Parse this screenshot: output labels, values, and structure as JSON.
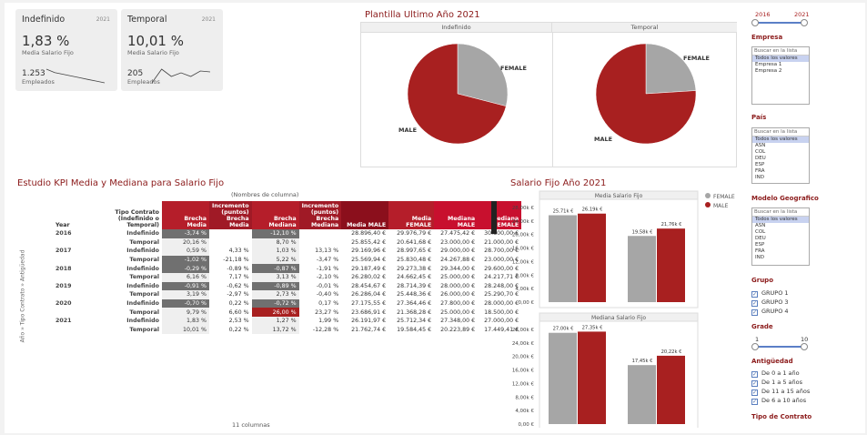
{
  "kpis": [
    {
      "title": "Indefinido",
      "year": "2021",
      "pct": "1,83 %",
      "pct_label": "Media Salario Fijo",
      "count": "1.253",
      "count_label": "Empleados",
      "spark": [
        22,
        20,
        19,
        18,
        17,
        16,
        15,
        14
      ]
    },
    {
      "title": "Temporal",
      "year": "2021",
      "pct": "10,01 %",
      "pct_label": "Media Salario Fijo",
      "count": "205",
      "count_label": "Empleados",
      "spark": [
        3,
        18,
        10,
        14,
        10,
        16,
        15
      ]
    }
  ],
  "pie_section": {
    "title": "Plantilla Ultimo Año 2021",
    "panels": [
      {
        "header": "Indefinido",
        "slices": [
          {
            "label": "FEMALE",
            "value": 29
          },
          {
            "label": "MALE",
            "value": 71
          }
        ]
      },
      {
        "header": "Temporal",
        "slices": [
          {
            "label": "FEMALE",
            "value": 24
          },
          {
            "label": "MALE",
            "value": 76
          }
        ]
      }
    ]
  },
  "table_section": {
    "title": "Estudio KPI Media y Mediana para Salario Fijo",
    "col_group": "(Nombres de columna)",
    "row_axis": "Año » Tipo Contrato » Antigüedad",
    "footer": "11 columnas",
    "headers": [
      "Year",
      "Tipo Contrato\n(Indefinido o\nTemporal)",
      "Brecha\nMedia",
      "Incremento\n(puntos)\nBrecha\nMedia",
      "Brecha\nMediana",
      "Incremento\n(puntos)\nBrecha\nMediana",
      "Media MALE",
      "Media\nFEMALE",
      "Mediana\nMALE",
      "Mediana\nFEMALE"
    ],
    "rows": [
      {
        "year": "2016",
        "tipo": "Indefinido",
        "c": [
          "-3,74 %",
          "",
          "-12,10 %",
          "",
          "28.896,40 €",
          "29.976,79 €",
          "27.475,42 €",
          "30.800,00 €"
        ],
        "hl": [
          "dark",
          "",
          "dark",
          ""
        ]
      },
      {
        "year": "",
        "tipo": "Temporal",
        "c": [
          "20,16 %",
          "",
          "8,70 %",
          "",
          "25.855,42 €",
          "20.641,68 €",
          "23.000,00 €",
          "21.000,00 €"
        ],
        "hl": [
          "",
          "",
          "",
          ""
        ]
      },
      {
        "year": "2017",
        "tipo": "Indefinido",
        "c": [
          "0,59 %",
          "4,33 %",
          "1,03 %",
          "13,13 %",
          "29.169,96 €",
          "28.997,65 €",
          "29.000,00 €",
          "28.700,00 €"
        ],
        "hl": [
          "",
          "",
          "",
          ""
        ]
      },
      {
        "year": "",
        "tipo": "Temporal",
        "c": [
          "-1,02 %",
          "-21,18 %",
          "5,22 %",
          "-3,47 %",
          "25.569,94 €",
          "25.830,48 €",
          "24.267,88 €",
          "23.000,00 €"
        ],
        "hl": [
          "dark",
          "",
          "",
          ""
        ]
      },
      {
        "year": "2018",
        "tipo": "Indefinido",
        "c": [
          "-0,29 %",
          "-0,89 %",
          "-0,87 %",
          "-1,91 %",
          "29.187,49 €",
          "29.273,38 €",
          "29.344,00 €",
          "29.600,00 €"
        ],
        "hl": [
          "dark",
          "",
          "dark",
          ""
        ]
      },
      {
        "year": "",
        "tipo": "Temporal",
        "c": [
          "6,16 %",
          "7,17 %",
          "3,13 %",
          "-2,10 %",
          "26.280,02 €",
          "24.662,45 €",
          "25.000,00 €",
          "24.217,71 €"
        ],
        "hl": [
          "",
          "",
          "",
          ""
        ]
      },
      {
        "year": "2019",
        "tipo": "Indefinido",
        "c": [
          "-0,91 %",
          "-0,62 %",
          "-0,89 %",
          "-0,01 %",
          "28.454,67 €",
          "28.714,39 €",
          "28.000,00 €",
          "28.248,00 €"
        ],
        "hl": [
          "dark",
          "",
          "dark",
          ""
        ]
      },
      {
        "year": "",
        "tipo": "Temporal",
        "c": [
          "3,19 %",
          "-2,97 %",
          "2,73 %",
          "-0,40 %",
          "26.286,04 €",
          "25.448,36 €",
          "26.000,00 €",
          "25.290,70 €"
        ],
        "hl": [
          "",
          "",
          "",
          ""
        ]
      },
      {
        "year": "2020",
        "tipo": "Indefinido",
        "c": [
          "-0,70 %",
          "0,22 %",
          "-0,72 %",
          "0,17 %",
          "27.175,55 €",
          "27.364,46 €",
          "27.800,00 €",
          "28.000,00 €"
        ],
        "hl": [
          "dark",
          "",
          "dark",
          ""
        ]
      },
      {
        "year": "",
        "tipo": "Temporal",
        "c": [
          "9,79 %",
          "6,60 %",
          "26,00 %",
          "23,27 %",
          "23.686,91 €",
          "21.368,28 €",
          "25.000,00 €",
          "18.500,00 €"
        ],
        "hl": [
          "",
          "",
          "red",
          ""
        ]
      },
      {
        "year": "2021",
        "tipo": "Indefinido",
        "c": [
          "1,83 %",
          "2,53 %",
          "1,27 %",
          "1,99 %",
          "26.191,97 €",
          "25.712,34 €",
          "27.348,00 €",
          "27.000,00 €"
        ],
        "hl": [
          "",
          "",
          "",
          ""
        ]
      },
      {
        "year": "",
        "tipo": "Temporal",
        "c": [
          "10,01 %",
          "0,22 %",
          "13,72 %",
          "-12,28 %",
          "21.762,74 €",
          "19.584,45 €",
          "20.223,89 €",
          "17.449,41 €"
        ],
        "hl": [
          "",
          "",
          "",
          ""
        ]
      }
    ]
  },
  "chart_data": [
    {
      "type": "bar",
      "title": "Salario Fijo Año 2021",
      "panel_title": "Media Salario Fijo",
      "categories": [
        "Indefinido",
        "Temporal"
      ],
      "series": [
        {
          "name": "FEMALE",
          "values": [
            25710,
            19580
          ],
          "labels": [
            "25,71k €",
            "19,58k €"
          ],
          "color": "#a6a6a6"
        },
        {
          "name": "MALE",
          "values": [
            26190,
            21760
          ],
          "labels": [
            "26,19k €",
            "21,76k €"
          ],
          "color": "#a82020"
        }
      ],
      "ylim": [
        0,
        28000
      ],
      "yticks": [
        "0,00 €",
        "4,00k €",
        "8,00k €",
        "12,00k €",
        "16,00k €",
        "20,00k €",
        "24,00k €",
        "28,00k €"
      ]
    },
    {
      "type": "bar",
      "panel_title": "Mediana Salario Fijo",
      "categories": [
        "Indefinido",
        "Temporal"
      ],
      "series": [
        {
          "name": "FEMALE",
          "values": [
            27000,
            17450
          ],
          "labels": [
            "27,00k €",
            "17,45k €"
          ],
          "color": "#a6a6a6"
        },
        {
          "name": "MALE",
          "values": [
            27350,
            20220
          ],
          "labels": [
            "27,35k €",
            "20,22k €"
          ],
          "color": "#a82020"
        }
      ],
      "ylim": [
        0,
        28000
      ],
      "yticks": [
        "0,00 €",
        "4,00k €",
        "8,00k €",
        "12,00k €",
        "16,00k €",
        "20,00k €",
        "24,00k €",
        "28,00k €"
      ]
    }
  ],
  "legend": [
    {
      "label": "FEMALE",
      "color": "#a6a6a6"
    },
    {
      "label": "MALE",
      "color": "#a82020"
    }
  ],
  "filters": {
    "year_range": {
      "min": "2016",
      "max": "2021"
    },
    "empresa": {
      "title": "Empresa",
      "search": "Buscar en la lista",
      "options": [
        "Todos los valores",
        "Empresa 1",
        "Empresa 2"
      ]
    },
    "pais": {
      "title": "País",
      "search": "Buscar en la lista",
      "options": [
        "Todos los valores",
        "ASN",
        "COL",
        "DEU",
        "ESP",
        "FRA",
        "IND"
      ]
    },
    "modelo": {
      "title": "Modelo Geografico",
      "search": "Buscar en la lista",
      "options": [
        "Todos los valores",
        "ASN",
        "COL",
        "DEU",
        "ESP",
        "FRA",
        "IND"
      ]
    },
    "grupo": {
      "title": "Grupo",
      "options": [
        "GRUPO 1",
        "GRUPO 3",
        "GRUPO 4"
      ]
    },
    "grade": {
      "title": "Grade",
      "min": "1",
      "max": "10"
    },
    "antiguedad": {
      "title": "Antigüedad",
      "options": [
        "De 0 a 1 año",
        "De 1 a 5 años",
        "De 11 a 15 años",
        "De 6 a 10 años"
      ]
    },
    "tipo_contrato": {
      "title": "Tipo de Contrato"
    }
  }
}
